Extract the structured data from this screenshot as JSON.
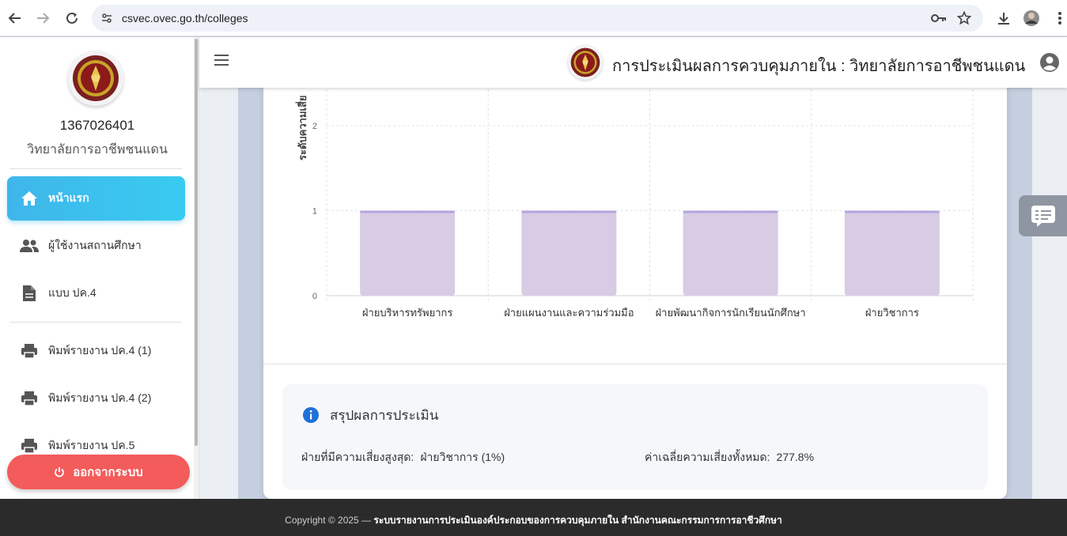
{
  "browser": {
    "url": "csvec.ovec.go.th/colleges",
    "icons": [
      "back-icon",
      "forward-icon",
      "reload-icon",
      "site-info-icon",
      "key-icon",
      "star-icon",
      "download-icon",
      "profile-avatar",
      "kebab-menu-icon"
    ]
  },
  "sidebar": {
    "college_code": "1367026401",
    "college_name": "วิทยาลัยการอาชีพชนแดน",
    "items": [
      {
        "label": "หน้าแรก",
        "icon": "home-icon",
        "active": true
      },
      {
        "label": "ผู้ใช้งานสถานศึกษา",
        "icon": "people-icon",
        "active": false
      },
      {
        "label": "แบบ ปค.4",
        "icon": "document-icon",
        "active": false
      },
      {
        "label": "พิมพ์รายงาน ปค.4 (1)",
        "icon": "printer-icon",
        "active": false
      },
      {
        "label": "พิมพ์รายงาน ปค.4 (2)",
        "icon": "printer-icon",
        "active": false
      },
      {
        "label": "พิมพ์รายงาน ปค.5",
        "icon": "printer-icon",
        "active": false
      }
    ],
    "logout_label": "ออกจากระบบ"
  },
  "header": {
    "title": "การประเมินผลการควบคุมภายใน : วิทยาลัยการอาชีพชนแดน"
  },
  "chart_data": {
    "type": "bar",
    "categories": [
      "ฝ่ายบริหารทรัพยากร",
      "ฝ่ายแผนงานและความร่วมมือ",
      "ฝ่ายพัฒนากิจการนักเรียนนักศึกษา",
      "ฝ่ายวิชาการ"
    ],
    "values": [
      1,
      1,
      1,
      1
    ],
    "ylabel": "ระดับความเสี่ย",
    "y_ticks": [
      "0",
      "1",
      "2"
    ],
    "ylim": [
      0,
      2
    ],
    "grid": true,
    "bar_color": "#d8cbe4",
    "bar_top_color": "#b3a6df"
  },
  "summary": {
    "title": "สรุปผลการประเมิน",
    "highest_risk_label": "ฝ่ายที่มีความเสี่ยงสูงสุด:",
    "highest_risk_value": "ฝ่ายวิชาการ (1%)",
    "avg_risk_label": "ค่าเฉลี่ยความเสี่ยงทั้งหมด:",
    "avg_risk_value": "277.8%"
  },
  "footer": {
    "prefix": "Copyright © 2025 —",
    "text": "ระบบรายงานการประเมินองค์ประกอบของการควบคุมภายใน สำนักงานคณะกรรมการการอาชีวศึกษา"
  }
}
